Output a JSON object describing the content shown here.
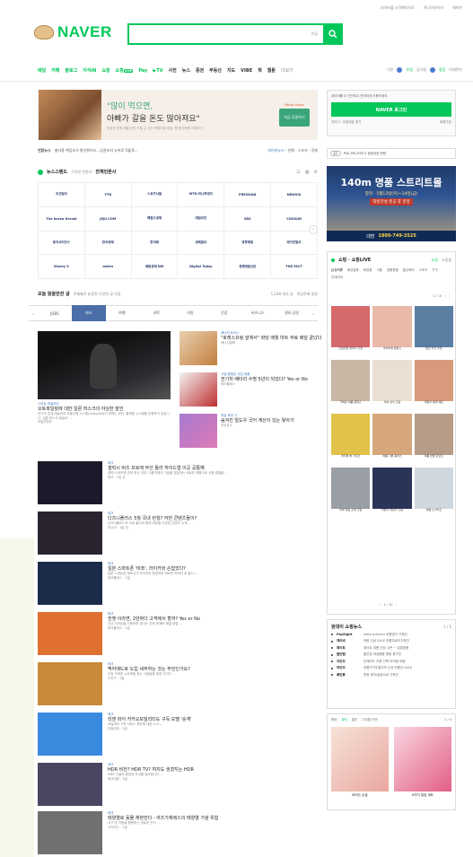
{
  "top": {
    "links": [
      "네이버를 시작페이지로",
      "쥬니어네이버",
      "해피빈"
    ]
  },
  "logo": {
    "text": "NAVER"
  },
  "search": {
    "placeholder": "",
    "ime": "한글"
  },
  "nav": {
    "items": [
      "메일",
      "카페",
      "블로그",
      "지식iN",
      "쇼핑",
      "쇼핑LIVE",
      "Pay",
      "▶TV",
      "사전",
      "뉴스",
      "증권",
      "부동산",
      "지도",
      "VIBE",
      "책",
      "웹툰",
      "더보기"
    ],
    "live_badge": "LIVE",
    "right": [
      "기온",
      "흐림",
      "공기질",
      "좋음",
      "미세먼지"
    ]
  },
  "ad": {
    "line1": "\"많이 먹으면,",
    "line2": "아빠가 갈을 돈도 많아져요\"",
    "line3": "방성연 후원 매월 돈만 드릴 수 있는 후원아동 제공, 웹 정기후원 자원하기",
    "cta": "지금 후원하기",
    "brand": "World Vision"
  },
  "newsline": {
    "label": "연합뉴스",
    "text": "충사용 책임조가 왕선화이스...상권조의 뉴프로 5월 8...",
    "right": [
      "네이버뉴스",
      "연예",
      "스포츠",
      "경제"
    ]
  },
  "newsstand": {
    "title": "뉴스스탠드",
    "sub1": "구독한 언론사",
    "sub2": "전체언론사",
    "press": [
      "조선일보",
      "YTN",
      "스포츠서울",
      "MTN 머니투데이",
      "PRESSIAN",
      "NEWSIS",
      "The Korea Herald",
      "JEJU.COM",
      "헤럴드경제",
      "데일리안",
      "SBS",
      "CHOSUN",
      "동아사이언스",
      "한국경제",
      "한겨레",
      "경제일보",
      "경향매일",
      "매거진일보",
      "Money S",
      "metro",
      "매일경제 NM",
      "Digital Today",
      "경제매일신문",
      "THE FACT"
    ]
  },
  "today": {
    "title": "오늘 읽을만한 글",
    "sub": "주제별로 분류된 다양한 글 모음",
    "right": "1,248 개의 글",
    "right2": "관심주제 설정"
  },
  "tabs": [
    "JOBS",
    "테크",
    "여행·",
    "과학",
    "리빙",
    "건강",
    "비즈니스",
    "엔터·공연"
  ],
  "feature": {
    "cat": "스마트 모빌리티",
    "title": "오토파일럿에 대한 일론 머스크의 야심한 발언",
    "desc": "전기차 업계 테슬라의 자율주행 시스템(Autopilot)이 미래는 밝아. 플랫폼 시스템을 운용하고 있습니다. 일론 머스크 테슬라 ...",
    "src": "모빌리언트"
  },
  "side_items": [
    {
      "cat": "에너지 트러스",
      "title": "\"로켓스프링 앞에서\" 화당 매월 마트 무료 배달 끝났다",
      "src": "에너지빌레"
    },
    {
      "cat": "사업·종합몬 사업 제품",
      "title": "전기차 배터리 수명 5년이 되었다? Yes or No",
      "src": "테크플레스"
    },
    {
      "cat": "마늘 포장 기",
      "title": "숨겨진 얼도우 국어 계산이 있는 닿아가",
      "src": "리빙몬스"
    }
  ],
  "feed": [
    {
      "cat": "테크",
      "title": "갤럭시 버즈 프로에 무선 들라 하이드형 이곳 공통해",
      "desc": "갤럭시 버즈에 관한 최신 리뷰. 이용자에게 기술을 전달하는 새로운 제품으로 사용 경험을 ...",
      "src": "테크 · 1일 전"
    },
    {
      "cat": "테크",
      "title": "디즈니플러스 5월 국내 런칭? 어떤 콘텐츠들이?",
      "desc": "디즈니플러스의 국내 출시와 함께 제공될 다양한 콘텐츠 소개 ...",
      "src": "미디어 · 1일 전"
    },
    {
      "cat": "테크",
      "title": "일본 스마트폰 '비쯔', 라이카와 손잡았다?",
      "desc": "일본 스마트폰 제조사가 라이카와 협업하여 새로운 카메라 폰 출시 ...",
      "src": "테크플러스 · 1일"
    },
    {
      "cat": "테크",
      "title": "전쟁 이라면, 2만하다 고객에서 할까? Yes or No",
      "desc": "무선 이어폰을 사용하면 생기는 흔한 문제와 해결 방법 ...",
      "src": "테크플러스 · 1일"
    },
    {
      "cat": "테크",
      "title": "맥어에드로 도입 세무하는 것는 무언인가요?",
      "desc": "가장 가벼운 노트북을 찾는 사람들을 위한 가이드 ...",
      "src": "IT친구 · 1일"
    },
    {
      "cat": "테크",
      "title": "리엔 피어 카카오모빌리티도 구독 모델 '승계'",
      "desc": "모빌리티 구독 서비스 확장에 대한 소식 ...",
      "src": "모빌리티 · 1일"
    },
    {
      "cat": "테크",
      "title": "HDR 비전? HDR TV? 여지도 생겼지는 HDR",
      "desc": "HDR 기술의 종류와 차이를 알아봅니다 ...",
      "src": "테크리뷰 · 1일"
    },
    {
      "cat": "테크",
      "title": "태양열로 동물 재현한다 - 여즈가제레스의 태양열 가을 위험",
      "desc": "지구 밖 자원을 활용하는 새로운 연구 ...",
      "src": "사이언스 · 1일"
    }
  ],
  "login": {
    "msg": "네이버를 더 안전하고 편리하게 이용하세요",
    "btn": "NAVER 로그인",
    "find": "아이디 · 비밀번호 찾기",
    "join": "회원가입"
  },
  "notice": {
    "pill": "공지",
    "text": "프로그모니터즈시 장원상호 텐핑"
  },
  "rad": {
    "big": "140m 명품 스트리트몰",
    "mid": "창약 · 5월13일(목)~14일(금)",
    "sub": "대방건설 준공 후 분양",
    "phone": "1800-749-3525",
    "label": "대방"
  },
  "shopping": {
    "title": "쇼핑 · 쇼핑LIVE",
    "tabs": [
      "쇼핑",
      "쇼핑몰"
    ],
    "cats": [
      "남성의류",
      "패션잡화",
      "화장품",
      "식품",
      "생활용품",
      "출산육아",
      "스포츠",
      "가구",
      "인테리어"
    ],
    "page": "1 / 10",
    "products": [
      {
        "c": "오일코팅 연마기 추천",
        "col": "#d66a6a"
      },
      {
        "c": "우아하게 원피스",
        "col": "#e8b8a8"
      },
      {
        "c": "팬츠 라인 추천",
        "col": "#5b7ea3"
      },
      {
        "c": "가벼운 여름 원피스",
        "col": "#c7b7a4"
      },
      {
        "c": "피부 관리 크림",
        "col": "#eadfd0"
      },
      {
        "c": "데일리 팔찌 세트",
        "col": "#d79a7a"
      },
      {
        "c": "캐주얼 뷰 가디건",
        "col": "#e2c24a"
      },
      {
        "c": "여름 기본 원피스",
        "col": "#d6a77b"
      },
      {
        "c": "여름 반팔 포인트",
        "col": "#b69c86"
      },
      {
        "c": "피부 맞춤 소재 크림",
        "col": "#9a9ea5"
      },
      {
        "c": "바쁘니 데일리 크림",
        "col": "#2a3458"
      },
      {
        "c": "여름 스니커즈",
        "col": "#cfd7df"
      }
    ],
    "pager2": "1 / 10"
  },
  "shoplist": {
    "title": "원대이 쇼핑뉴스",
    "page": "1 / 5",
    "rows": [
      {
        "b": "PaySight",
        "v": "hello summer 여름맞이 기획전"
      },
      {
        "b": "캐리비",
        "v": "캐링 신상 SALE 여름무료이기획전"
      },
      {
        "b": "제이트",
        "v": "제이트 여름 신상 시즌 ~ 업업표움"
      },
      {
        "b": "클린랩",
        "v": "홈인장 위생용품 종합 특가전"
      },
      {
        "b": "지민모",
        "v": "언제라도 지원 선택 아이템 모음"
      },
      {
        "b": "여민모",
        "v": "여름가가주점주의 신상 여름산 SALE"
      },
      {
        "b": "배민뷰",
        "v": "한정 뷰티/살림으로 기획전"
      }
    ]
  },
  "shopcard": {
    "tabs": [
      "패션",
      "뷰티",
      "홈인",
      "디지털·가전"
    ],
    "items": [
      {
        "c": "바라는 손질"
      },
      {
        "c": "6가지 컬업 세트"
      }
    ],
    "page": "1 / 4"
  },
  "colors": {
    "brand": "#03c75a",
    "tab_on": "#4a6ea8",
    "link": "#3c78c2"
  }
}
